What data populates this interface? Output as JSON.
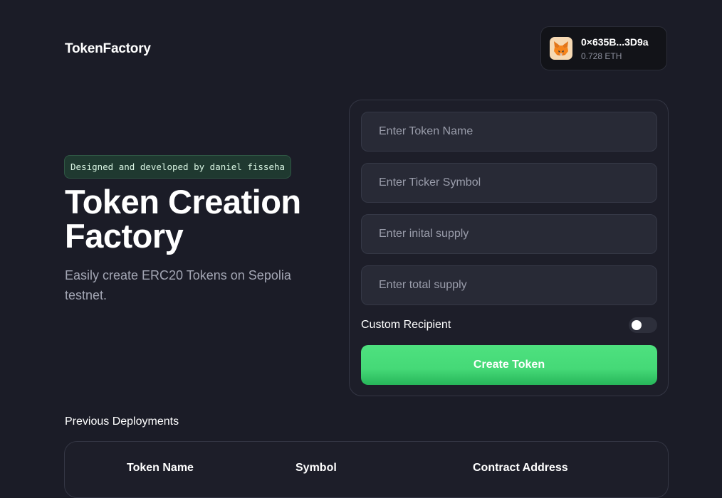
{
  "brand": {
    "name": "TokenFactory"
  },
  "wallet": {
    "address": "0×635B...3D9a",
    "balance": "0.728 ETH",
    "avatar_icon": "metamask-fox-icon"
  },
  "hero": {
    "badge": "Designed and developed by daniel fisseha",
    "title": "Token Creation Factory",
    "subtitle": "Easily create ERC20 Tokens on Sepolia testnet."
  },
  "form": {
    "token_name_placeholder": "Enter Token Name",
    "ticker_placeholder": "Enter Ticker Symbol",
    "initial_supply_placeholder": "Enter inital supply",
    "total_supply_placeholder": "Enter total supply",
    "custom_recipient_label": "Custom Recipient",
    "custom_recipient_enabled": false,
    "create_label": "Create Token"
  },
  "deployments": {
    "title": "Previous Deployments",
    "columns": [
      "Token Name",
      "Symbol",
      "Contract Address"
    ]
  },
  "colors": {
    "background": "#1b1c27",
    "accent": "#45d977",
    "card": "#1d1e29",
    "badge_bg": "#1f3930"
  }
}
